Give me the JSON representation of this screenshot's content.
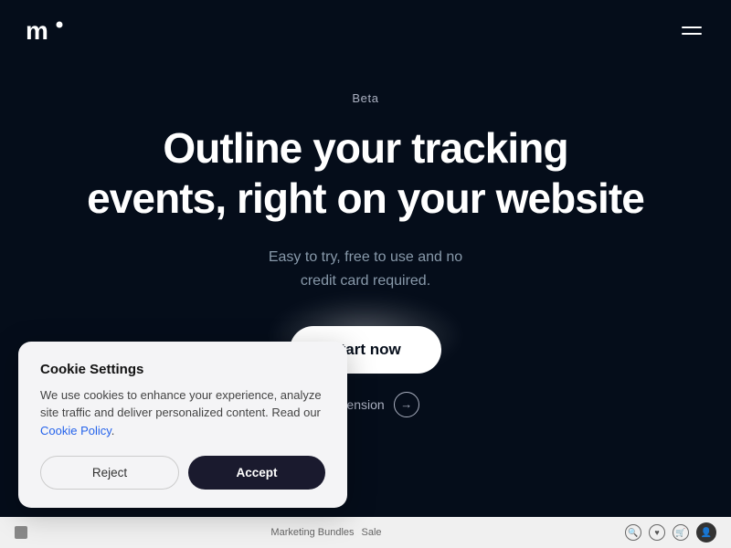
{
  "header": {
    "logo_alt": "Brand logo",
    "menu_label": "Menu"
  },
  "hero": {
    "badge": "Beta",
    "title_line1": "Outline your tracking",
    "title_line2": "events, right on your website",
    "subtitle_line1": "Easy to try, free to use and no",
    "subtitle_line2": "credit card required.",
    "cta_button": "Start now",
    "extension_text": "he extension"
  },
  "bottom_bar": {
    "tags": [
      "Marketing Bundles",
      "Sale"
    ],
    "icons": [
      "search",
      "heart",
      "cart",
      "user"
    ]
  },
  "cookie": {
    "title": "Cookie Settings",
    "body": "We use cookies to enhance your experience, analyze site traffic and deliver personalized content. Read our ",
    "policy_link": "Cookie Policy",
    "body_end": ".",
    "reject_label": "Reject",
    "accept_label": "Accept"
  }
}
